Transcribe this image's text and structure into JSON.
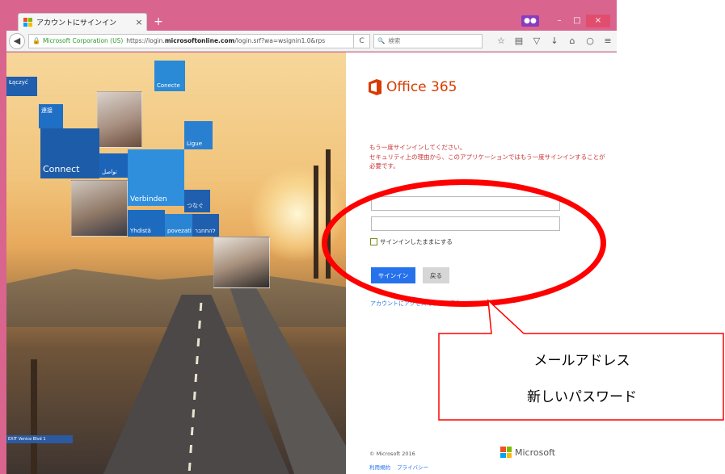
{
  "browser": {
    "tab_title": "アカウントにサインイン",
    "tab_close": "×",
    "new_tab": "+",
    "org_name": "Microsoft Corporation (US)",
    "url_prefix": "https://login.",
    "url_domain": "microsoftonline.com",
    "url_suffix": "/login.srf?wa=wsignin1.0&rps",
    "search_placeholder": "検索",
    "window_controls": {
      "minimize": "–",
      "maximize": "□",
      "close": "×"
    }
  },
  "hero": {
    "tiles": [
      "Łączyć",
      "Conecte",
      "連接",
      "Ligue",
      "Connect",
      "تواصل",
      "Verbinden",
      "つなぐ",
      "Yhdistä",
      "povezati",
      "להתחבר"
    ],
    "sign": "EXIT Venice Blvd 1"
  },
  "login": {
    "product_name": "Office 365",
    "message_line1": "もう一度サインインしてください。",
    "message_line2": "セキュリティ上の理由から、このアプリケーションではもう一度サインインすることが必要です。",
    "email_value": "",
    "password_value": "",
    "keep_signed_in_label": "サインインしたままにする",
    "signin_button": "サインイン",
    "back_button": "戻る",
    "cant_access_link": "アカウントにアクセスできない場合",
    "copyright": "© Microsoft 2016",
    "link_terms": "利用規約",
    "link_privacy": "プライバシー",
    "ms_brand": "Microsoft"
  },
  "annotation": {
    "line1": "メールアドレス",
    "line2": "新しいパスワード",
    "color": "#ff0000"
  },
  "colors": {
    "window_frame": "#d9648e",
    "office_orange": "#d83b01",
    "signin_blue": "#2672ec",
    "message_red": "#cc3333"
  }
}
